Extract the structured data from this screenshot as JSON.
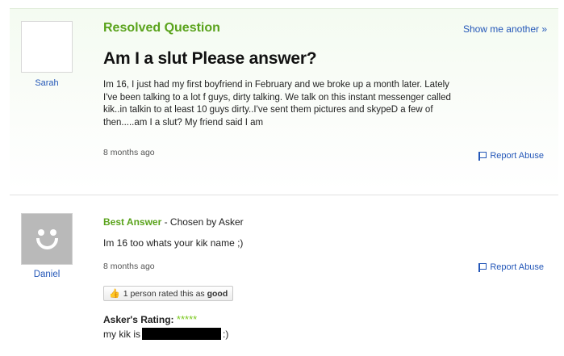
{
  "question": {
    "asker_name": "Sarah",
    "status_label": "Resolved Question",
    "show_another_label": "Show me another »",
    "title": "Am I a slut Please answer?",
    "body_lines": [
      "Im 16, I just had my first boyfriend in February and we broke up a month later. Lately",
      "I've been talking to a lot f guys, dirty talking. We talk on this instant messenger called",
      "kik..in talkin to at least 10 guys dirty..I've sent them pictures and skypeD a few of",
      "then.....am I a slut? My friend said I am"
    ],
    "time_ago": "8 months ago",
    "report_label": "Report Abuse"
  },
  "answer": {
    "answerer_name": "Daniel",
    "best_answer_label": "Best Answer",
    "chosen_by_label": " - Chosen by Asker",
    "body": "Im 16 too whats your kik name ;)",
    "time_ago": "8 months ago",
    "report_label": "Report Abuse",
    "rated_prefix": "1 person rated this as ",
    "rated_value": "good",
    "asker_rating_label": "Asker's Rating: ",
    "asker_rating_stars": "*****",
    "asker_rating_value": 5,
    "asker_comment_prefix": "my kik is",
    "asker_comment_suffix": ":)"
  },
  "colors": {
    "accent_green": "#5aa31c",
    "link_blue": "#2457b8",
    "star_green": "#7bc81f"
  },
  "icons": [
    "flag-icon",
    "thumbs-up-icon",
    "default-avatar-icon"
  ]
}
